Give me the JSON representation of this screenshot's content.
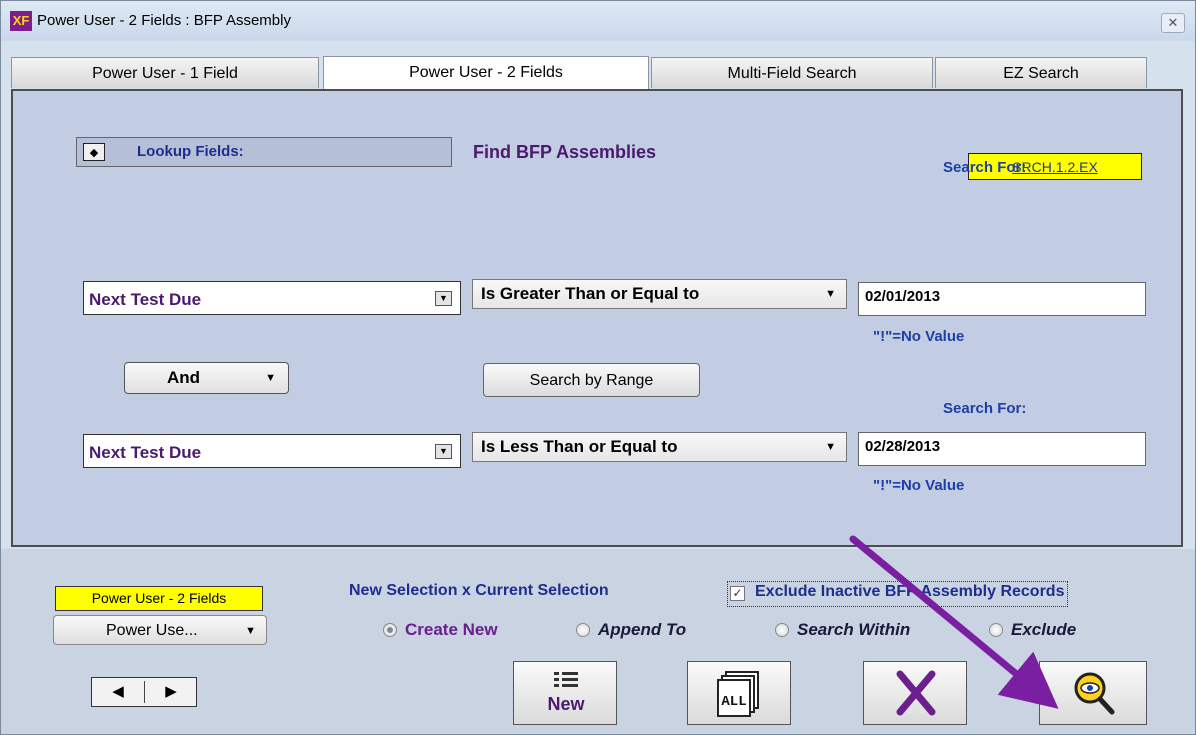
{
  "window": {
    "title": "Power User - 2 Fields : BFP Assembly",
    "icon_text": "XF",
    "close_glyph": "✕"
  },
  "tabs": [
    {
      "label": "Power User - 1 Field",
      "active": false
    },
    {
      "label": "Power User - 2 Fields",
      "active": true
    },
    {
      "label": "Multi-Field Search",
      "active": false
    },
    {
      "label": "EZ Search",
      "active": false
    }
  ],
  "panel": {
    "code_badge": "SRCH.1.2.EX",
    "lookup_label": "Lookup Fields:",
    "find_label": "Find BFP Assemblies",
    "row1": {
      "field": "Next Test Due",
      "operator": "Is Greater Than or Equal to",
      "search_for_label": "Search For:",
      "value": "02/01/2013",
      "no_value_hint": "\"!\"=No Value"
    },
    "connector": "And",
    "range_button": "Search by Range",
    "row2": {
      "field": "Next Test Due",
      "operator": "Is Less Than or Equal to",
      "search_for_label": "Search For:",
      "value": "02/28/2013",
      "no_value_hint": "\"!\"=No Value"
    }
  },
  "bottom": {
    "yellow_label": "Power User - 2 Fields",
    "mode_select": "Power Use...",
    "selection_label": "New Selection x Current Selection",
    "exclude_inactive": {
      "label": "Exclude Inactive BFP Assembly Records",
      "checked": true
    },
    "radios": [
      {
        "label": "Create New",
        "selected": true
      },
      {
        "label": "Append To",
        "selected": false
      },
      {
        "label": "Search Within",
        "selected": false
      },
      {
        "label": "Exclude",
        "selected": false
      }
    ],
    "buttons": {
      "new_label": "New",
      "all_label": "ALL"
    }
  },
  "colors": {
    "panel_bg": "#c2cce2",
    "label_blue": "#1d3fa8",
    "field_purple": "#4a1a6e",
    "badge_yellow": "#ffff00",
    "arrow_purple": "#7b1fa2"
  },
  "icons": [
    "diamond-icon",
    "chevron-down-icon",
    "left-arrow-icon",
    "right-arrow-icon",
    "new-list-icon",
    "all-records-icon",
    "close-x-icon",
    "magnifier-eye-icon"
  ]
}
